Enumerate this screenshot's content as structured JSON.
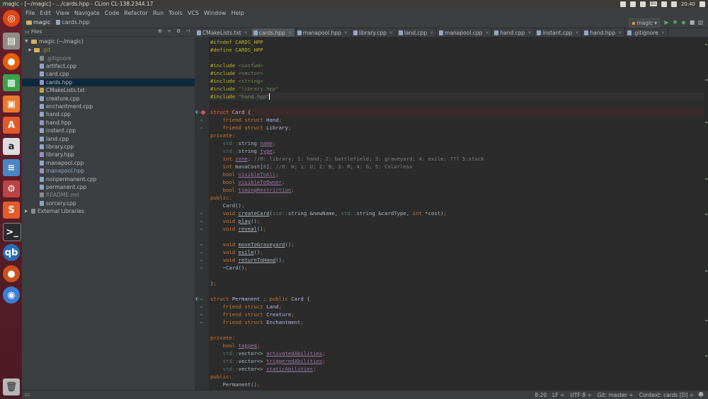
{
  "window": {
    "title": "magic - [~/magic] - .../cards.hpp - CLion CL-138.2344.17"
  },
  "tray": {
    "lang": "En",
    "time": "20:40"
  },
  "menu": [
    "File",
    "Edit",
    "View",
    "Navigate",
    "Code",
    "Refactor",
    "Run",
    "Tools",
    "VCS",
    "Window",
    "Help"
  ],
  "nav": {
    "project": "magic",
    "file": "cards.hpp",
    "run_config": "magic"
  },
  "project_panel": {
    "header": "Files",
    "root": "magic (~/magic)",
    "items": [
      ".git",
      ".gitignore",
      "artifact.cpp",
      "card.cpp",
      "cards.hpp",
      "CMakeLists.txt",
      "creature.cpp",
      "enchantment.cpp",
      "hand.cpp",
      "hand.hpp",
      "instant.cpp",
      "land.cpp",
      "library.cpp",
      "library.hpp",
      "manapool.cpp",
      "manapool.hpp",
      "nonpermanent.cpp",
      "permanent.cpp",
      "README.md",
      "sorcery.cpp"
    ],
    "external": "External Libraries",
    "selected": "cards.hpp"
  },
  "tabs": [
    "CMakeLists.txt",
    "cards.hpp",
    "manapool.hpp",
    "library.cpp",
    "land.cpp",
    "manapool.cpp",
    "hand.cpp",
    "instant.cpp",
    "hand.hpp",
    ".gitignore"
  ],
  "status": {
    "position": "8:20",
    "line_sep": "LF ÷",
    "encoding": "UTF-8 ÷",
    "git": "Git: master ÷",
    "context": "Context: cards [D] ÷"
  },
  "colors": {
    "keyword": "#cc7832",
    "preprocessor": "#bbb529",
    "string": "#6a8759",
    "comment": "#808080"
  }
}
